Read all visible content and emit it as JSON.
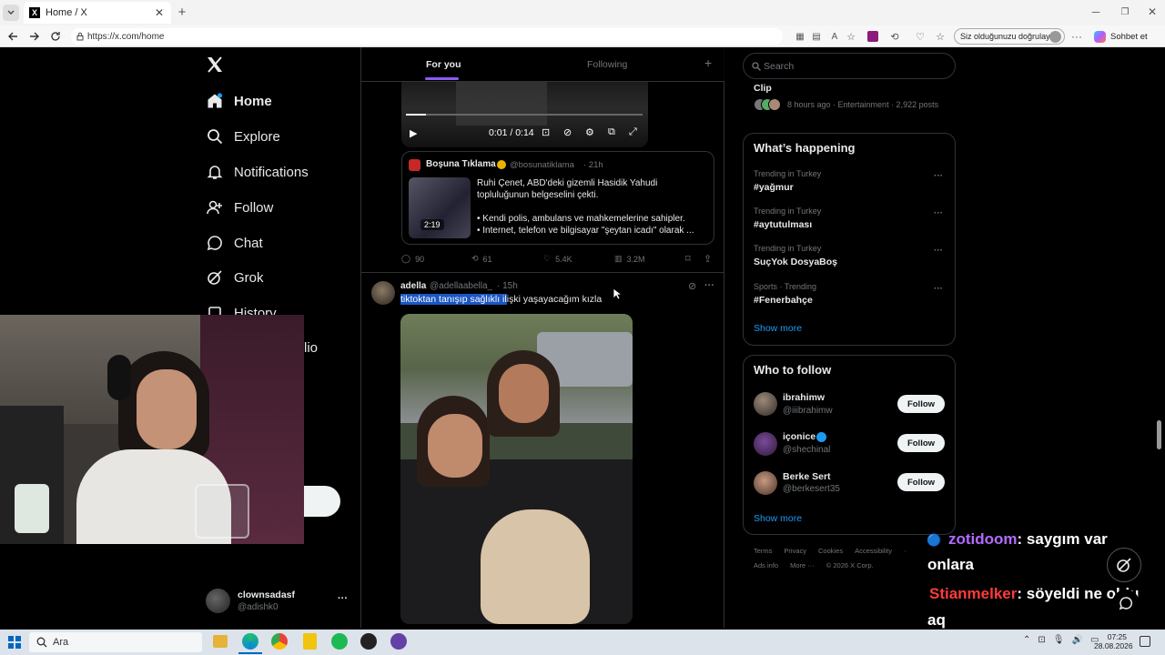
{
  "browser": {
    "tab_title": "Home / X",
    "url": "https://x.com/home",
    "verify_label": "Siz olduğunuzu doğrulayın",
    "copilot_label": "Sohbet et"
  },
  "sidebar": {
    "items": [
      {
        "label": "Home",
        "icon": "home-icon"
      },
      {
        "label": "Explore",
        "icon": "search-icon"
      },
      {
        "label": "Notifications",
        "icon": "bell-icon"
      },
      {
        "label": "Follow",
        "icon": "add-user-icon"
      },
      {
        "label": "Chat",
        "icon": "chat-icon"
      },
      {
        "label": "Grok",
        "icon": "grok-icon"
      },
      {
        "label": "History",
        "icon": "history-icon"
      }
    ],
    "partial_label": "lio",
    "account": {
      "name": "clownsadasf",
      "handle": "@adishk0",
      "more": "···"
    }
  },
  "feed": {
    "tabs": [
      {
        "label": "For you"
      },
      {
        "label": "Following"
      }
    ],
    "add_tab": "+",
    "video": {
      "time": "0:01 / 0:14"
    },
    "quote": {
      "name": "Boşuna Tıklama",
      "handle": "@bosunatiklama",
      "time": "· 21h",
      "text1": "Ruhi Çenet, ABD'deki gizemli Hasidik Yahudi topluluğunun belgeselini çekti.",
      "text2": "• Kendi polis, ambulans ve mahkemelerine sahipler.",
      "text3": "• İnternet, telefon ve bilgisayar \"şeytan icadı\" olarak ...",
      "duration": "2:19"
    },
    "actions": {
      "replies": "90",
      "reposts": "61",
      "likes": "5.4K",
      "views": "3.2M"
    },
    "post": {
      "name": "adella",
      "handle": "@adellaabella_",
      "time": "· 15h",
      "text_selected": "tiktoktan tanışıp sağlıklı il",
      "text_rest": "işki yaşayacağım kızla",
      "more": "···"
    }
  },
  "right": {
    "search_placeholder": "Search",
    "clip": {
      "title": "Clip",
      "meta": "8 hours ago · Entertainment · 2,922 posts"
    },
    "happening": {
      "title": "What’s happening",
      "trends": [
        {
          "cat": "Trending in Turkey",
          "name": "#yağmur"
        },
        {
          "cat": "Trending in Turkey",
          "name": "#aytutulması"
        },
        {
          "cat": "Trending in Turkey",
          "name": "SuçYok DosyaBoş"
        },
        {
          "cat": "Sports · Trending",
          "name": "#Fenerbahçe"
        }
      ],
      "show_more": "Show more"
    },
    "who": {
      "title": "Who to follow",
      "users": [
        {
          "name": "ibrahimw",
          "handle": "@iiibrahimw",
          "btn": "Follow"
        },
        {
          "name": "içonice",
          "handle": "@shechinal",
          "btn": "Follow"
        },
        {
          "name": "Berke Sert",
          "handle": "@berkesert35",
          "btn": "Follow"
        }
      ],
      "show_more": "Show more"
    },
    "footer": {
      "l1": [
        "Terms",
        "Privacy",
        "Cookies",
        "Accessibility",
        "·"
      ],
      "ads": "Ads info",
      "more": "More ···",
      "copy": "© 2026 X Corp."
    }
  },
  "overlay": {
    "chat": [
      {
        "user": "zotidoom",
        "msg": ": saygım var",
        "cont": "onlara",
        "color": "#b36bff"
      },
      {
        "user": "Stianmelker",
        "msg": ": söyeldi ne oldu",
        "cont": "aq",
        "color": "#ff3b3b"
      }
    ]
  },
  "taskbar": {
    "search": "Ara",
    "time": "07:25",
    "date": "28.08.2026"
  }
}
